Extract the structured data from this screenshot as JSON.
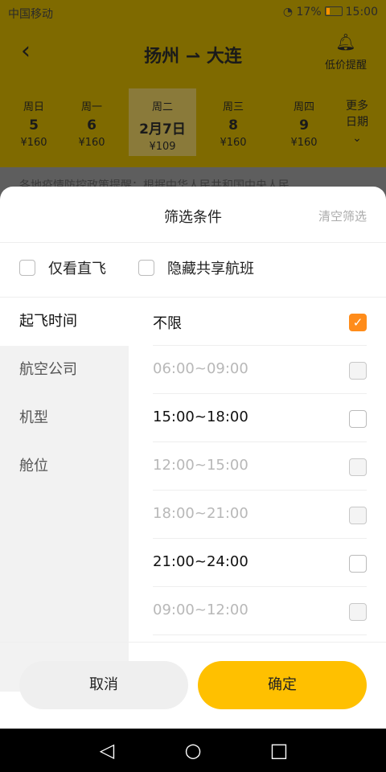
{
  "status": {
    "carrier": "中国移动",
    "battery": "17%",
    "time": "15:00"
  },
  "header": {
    "route_from": "扬州",
    "route_to": "大连",
    "alert_label": "低价提醒",
    "more_dates": [
      "更多",
      "日期"
    ],
    "dates": [
      {
        "weekday": "周日",
        "day": "5",
        "price": "¥160"
      },
      {
        "weekday": "周一",
        "day": "6",
        "price": "¥160"
      },
      {
        "weekday": "周二",
        "day": "2月7日",
        "price": "¥109",
        "selected": true
      },
      {
        "weekday": "周三",
        "day": "8",
        "price": "¥160"
      },
      {
        "weekday": "周四",
        "day": "9",
        "price": "¥160"
      }
    ]
  },
  "notice": "各地疫情防控政策提醒：根据中华人民共和国中央人民",
  "sheet": {
    "title": "筛选条件",
    "clear": "清空筛选",
    "options": {
      "direct": "仅看直飞",
      "hide_shared": "隐藏共享航班"
    },
    "categories": [
      "起飞时间",
      "航空公司",
      "机型",
      "舱位"
    ],
    "time_options": [
      {
        "label": "不限",
        "state": "checked"
      },
      {
        "label": "06:00~09:00",
        "state": "disabled"
      },
      {
        "label": "15:00~18:00",
        "state": "enabled"
      },
      {
        "label": "12:00~15:00",
        "state": "disabled"
      },
      {
        "label": "18:00~21:00",
        "state": "disabled"
      },
      {
        "label": "21:00~24:00",
        "state": "enabled"
      },
      {
        "label": "09:00~12:00",
        "state": "disabled"
      }
    ],
    "cancel": "取消",
    "confirm": "确定"
  },
  "colors": {
    "accent": "#ffc000",
    "check": "#ff8c1a"
  }
}
